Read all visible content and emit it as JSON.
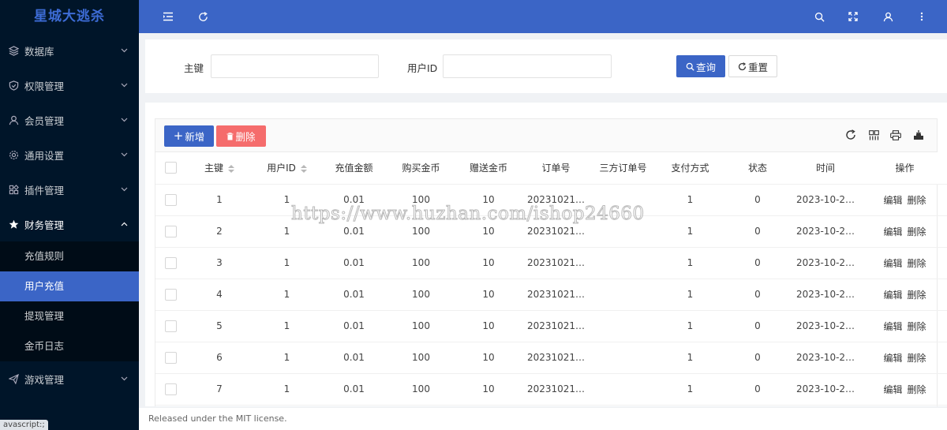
{
  "app": {
    "brand": "星城大逃杀"
  },
  "sidebar": {
    "items": [
      {
        "label": "数据库",
        "icon": "database-icon"
      },
      {
        "label": "权限管理",
        "icon": "shield-icon"
      },
      {
        "label": "会员管理",
        "icon": "user-icon"
      },
      {
        "label": "通用设置",
        "icon": "gear-icon"
      },
      {
        "label": "插件管理",
        "icon": "plugin-icon"
      },
      {
        "label": "财务管理",
        "icon": "star-icon",
        "open": true
      },
      {
        "label": "游戏管理",
        "icon": "send-icon"
      }
    ],
    "finance_sub": [
      {
        "label": "充值规则"
      },
      {
        "label": "用户充值",
        "active": true
      },
      {
        "label": "提现管理"
      },
      {
        "label": "金币日志"
      }
    ],
    "status_tip": "avascript:;"
  },
  "search": {
    "pk_label": "主键",
    "pk_value": "",
    "uid_label": "用户ID",
    "uid_value": "",
    "query_label": "查询",
    "reset_label": "重置"
  },
  "toolbar": {
    "add_label": "新增",
    "delete_label": "删除"
  },
  "table": {
    "headers": [
      "主键",
      "用户ID",
      "充值金额",
      "购买金币",
      "赠送金币",
      "订单号",
      "三方订单号",
      "支付方式",
      "状态",
      "时间",
      "操作"
    ],
    "rows": [
      [
        "1",
        "1",
        "0.01",
        "100",
        "10",
        "20231021…",
        "",
        "1",
        "0",
        "2023-10-2…"
      ],
      [
        "2",
        "1",
        "0.01",
        "100",
        "10",
        "20231021…",
        "",
        "1",
        "0",
        "2023-10-2…"
      ],
      [
        "3",
        "1",
        "0.01",
        "100",
        "10",
        "20231021…",
        "",
        "1",
        "0",
        "2023-10-2…"
      ],
      [
        "4",
        "1",
        "0.01",
        "100",
        "10",
        "20231021…",
        "",
        "1",
        "0",
        "2023-10-2…"
      ],
      [
        "5",
        "1",
        "0.01",
        "100",
        "10",
        "20231021…",
        "",
        "1",
        "0",
        "2023-10-2…"
      ],
      [
        "6",
        "1",
        "0.01",
        "100",
        "10",
        "20231021…",
        "",
        "1",
        "0",
        "2023-10-2…"
      ],
      [
        "7",
        "1",
        "0.01",
        "100",
        "10",
        "20231021…",
        "",
        "1",
        "0",
        "2023-10-2…"
      ]
    ],
    "edit_label": "编辑",
    "delete_label": "删除"
  },
  "watermark": "https://www.huzhan.com/ishop24660",
  "footer": {
    "text": "Released under the MIT license."
  },
  "colors": {
    "sidebar_bg": "#001529",
    "primary": "#3b65c6",
    "danger": "#f56c6c"
  }
}
